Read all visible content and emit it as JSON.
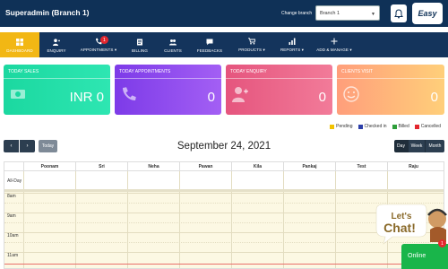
{
  "header": {
    "title": "Superadmin (Branch 1)",
    "branch_label": "Change branch",
    "branch_value": "Branch 1",
    "logo_text": "Easy",
    "icons": {
      "bell": "bell-icon",
      "dropdown": "chevron-down-icon"
    }
  },
  "nav": {
    "items": [
      {
        "label": "Dashboard",
        "icon": "dashboard-icon",
        "active": true
      },
      {
        "label": "Enquiry",
        "icon": "user-plus-icon"
      },
      {
        "label": "Appointments ▾",
        "icon": "phone-icon",
        "badge": "1"
      },
      {
        "label": "Billing",
        "icon": "billing-icon"
      },
      {
        "label": "Clients",
        "icon": "clients-icon"
      },
      {
        "label": "Feedbacks",
        "icon": "feedback-icon"
      },
      {
        "label": "Products ▾",
        "icon": "cart-icon"
      },
      {
        "label": "Reports ▾",
        "icon": "bar-chart-icon"
      },
      {
        "label": "Add & Manage ▾",
        "icon": "plus-icon"
      }
    ]
  },
  "cards": [
    {
      "title": "Today Sales",
      "value": "INR 0",
      "icon": "money-icon",
      "color": "#1bd8a0"
    },
    {
      "title": "Today Appointments",
      "value": "0",
      "icon": "phone-icon",
      "color": "#7d3be8"
    },
    {
      "title": "Today Enquiry",
      "value": "0",
      "icon": "user-plus-icon",
      "color": "#e5557e"
    },
    {
      "title": "Clients Visit",
      "value": "0",
      "icon": "smile-icon",
      "color": "#ff9e7b"
    }
  ],
  "legend": [
    {
      "label": "Pending",
      "color": "#f2c200"
    },
    {
      "label": "Checked in",
      "color": "#2c3ea8"
    },
    {
      "label": "Billed",
      "color": "#2e9e3a"
    },
    {
      "label": "Cancelled",
      "color": "#e3262e"
    }
  ],
  "calendar": {
    "title": "September 24, 2021",
    "prev": "‹",
    "next": "›",
    "today": "Today",
    "views": [
      "Day",
      "Week",
      "Month"
    ],
    "active_view": "Day",
    "staff": [
      "Poonam",
      "Sri",
      "Neha",
      "Pawan",
      "Kila",
      "Pankaj",
      "Test",
      "Raju"
    ],
    "all_day": "All-Day",
    "times": [
      "8am",
      "9am",
      "10am",
      "11am"
    ]
  },
  "chat": {
    "bubble_text_1": "Let's",
    "bubble_text_2": "Chat!",
    "online_label": "Online",
    "badge": "1"
  }
}
